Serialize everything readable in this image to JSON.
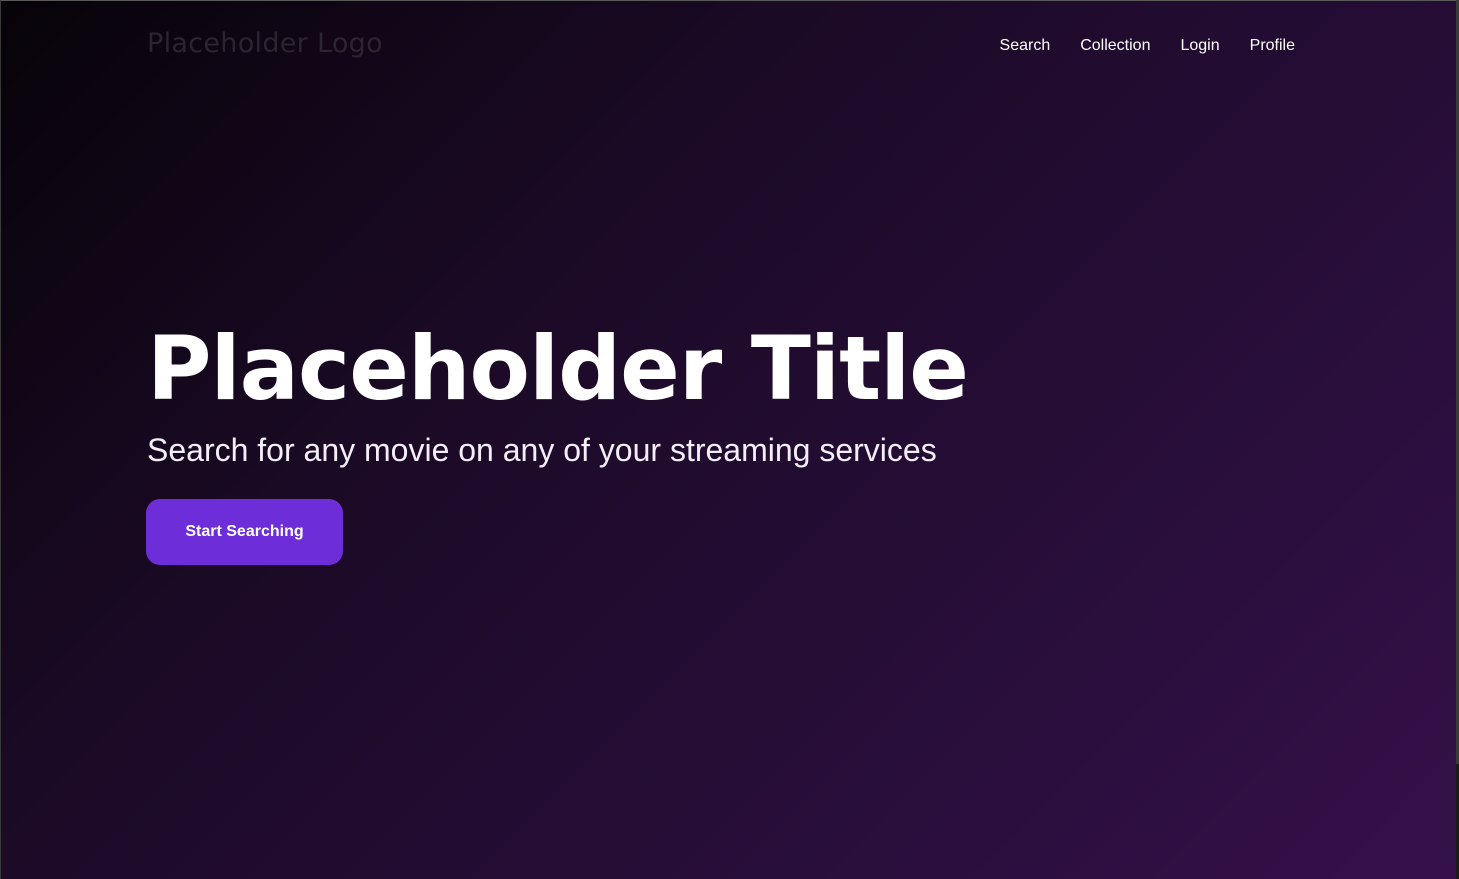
{
  "header": {
    "logo_text": "Placeholder Logo",
    "nav": [
      {
        "label": "Search"
      },
      {
        "label": "Collection"
      },
      {
        "label": "Login"
      },
      {
        "label": "Profile"
      }
    ]
  },
  "hero": {
    "title": "Placeholder Title",
    "subtitle": "Search for any movie on any of your streaming services",
    "cta_label": "Start Searching"
  },
  "colors": {
    "accent": "#6d2ed9",
    "background_start": "#070309",
    "background_end": "#35104a",
    "text": "#ffffff"
  }
}
